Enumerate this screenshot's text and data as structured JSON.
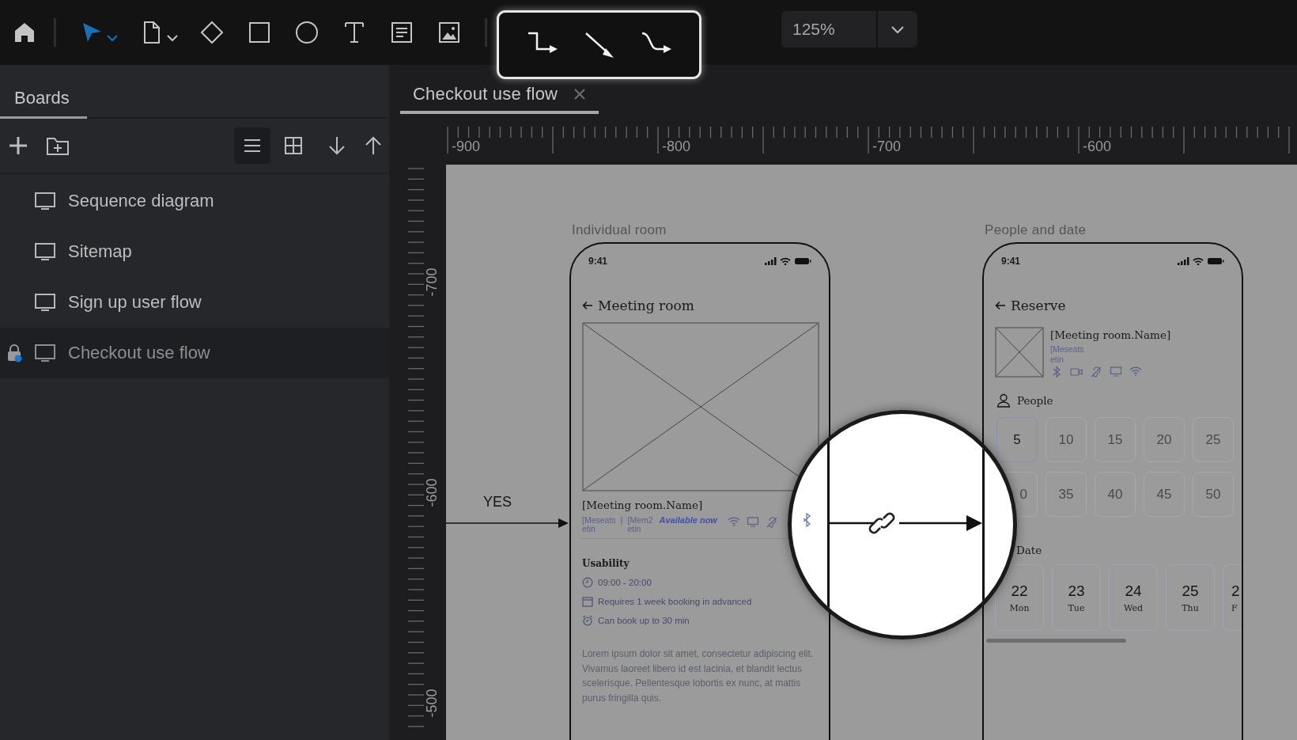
{
  "toolbar": {
    "tools": [
      {
        "kind": "home",
        "selected": false
      },
      {
        "kind": "pointer",
        "selected": true
      },
      {
        "kind": "page",
        "selected": false
      },
      {
        "kind": "diamond",
        "selected": false
      },
      {
        "kind": "rectangle",
        "selected": false
      },
      {
        "kind": "ellipse",
        "selected": false
      },
      {
        "kind": "text",
        "selected": false
      },
      {
        "kind": "note",
        "selected": false
      },
      {
        "kind": "image",
        "selected": false
      }
    ],
    "connectors": [
      {
        "kind": "elbow"
      },
      {
        "kind": "straight"
      },
      {
        "kind": "curved"
      }
    ],
    "zoom": "125%"
  },
  "sidebar": {
    "tab": "Boards",
    "views": [
      {
        "kind": "list",
        "selected": true
      },
      {
        "kind": "grid",
        "selected": false
      }
    ],
    "boards": [
      {
        "label": "Sequence diagram",
        "selected": false,
        "locked": false
      },
      {
        "label": "Sitemap",
        "selected": false,
        "locked": false
      },
      {
        "label": "Sign up user flow",
        "selected": false,
        "locked": false
      },
      {
        "label": "Checkout use flow",
        "selected": true,
        "locked": true
      }
    ]
  },
  "document_tab": "Checkout use flow",
  "rulers": {
    "horizontal": [
      "-900",
      "-800",
      "-700",
      "-600"
    ],
    "vertical": [
      "-700",
      "-600",
      "-500"
    ]
  },
  "canvas": {
    "connector_label": "YES",
    "room_screen": {
      "title": "Individual room",
      "time": "9:41",
      "header": "Meeting room",
      "room_name": "[Meeting room.Name]",
      "meta": [
        {
          "text": "[Meseats",
          "sub": "etin"
        },
        {
          "text": "[Mem2",
          "sub": "etin"
        }
      ],
      "separator": "|",
      "availability": "Available now",
      "usability": "Usability",
      "facts": [
        {
          "kind": "clock",
          "text": "09:00 - 20:00"
        },
        {
          "kind": "calendar",
          "text": "Requires 1 week booking in advanced"
        },
        {
          "kind": "alarm",
          "text": "Can book up to 30 min"
        }
      ],
      "description": "Lorem ipsum dolor sit amet, consectetur adipiscing elit. Vivamus laoreet libero id est lacinia, et blandit lectus scelerisque. Pellentesque lobortis ex nunc, at mattis purus fringilla quis."
    },
    "reserve_screen": {
      "title": "People and date",
      "time": "9:41",
      "header": "Reserve",
      "room_name": "[Meeting room.Name]",
      "meta": "[Meseats",
      "meta_sub": "etin",
      "people_label": "People",
      "people": [
        {
          "value": "5",
          "selected": true
        },
        {
          "value": "10",
          "selected": false
        },
        {
          "value": "15",
          "selected": false
        },
        {
          "value": "20",
          "selected": false
        },
        {
          "value": "25",
          "selected": false
        },
        {
          "value": "0",
          "selected": false
        },
        {
          "value": "35",
          "selected": false
        },
        {
          "value": "40",
          "selected": false
        },
        {
          "value": "45",
          "selected": false
        },
        {
          "value": "50",
          "selected": false
        }
      ],
      "date_label": "Date",
      "dates": [
        {
          "day": "22",
          "weekday": "Mon"
        },
        {
          "day": "23",
          "weekday": "Tue"
        },
        {
          "day": "24",
          "weekday": "Wed"
        },
        {
          "day": "25",
          "weekday": "Thu"
        },
        {
          "day": "2",
          "weekday": "F"
        }
      ]
    }
  }
}
